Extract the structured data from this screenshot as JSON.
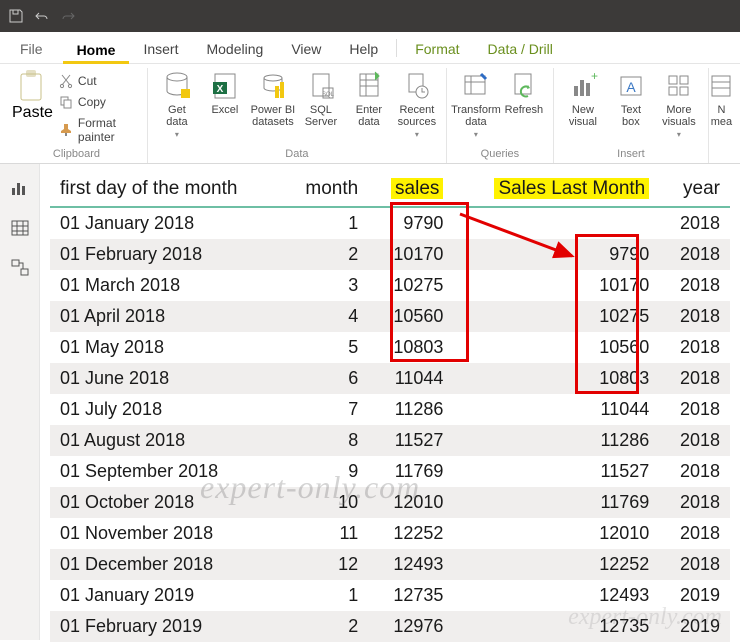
{
  "titlebar": {
    "save_icon": "save",
    "undo_icon": "undo",
    "redo_icon": "redo"
  },
  "tabs": {
    "file": "File",
    "home": "Home",
    "insert": "Insert",
    "modeling": "Modeling",
    "view": "View",
    "help": "Help",
    "format": "Format",
    "datadrill": "Data / Drill"
  },
  "ribbon": {
    "clipboard": {
      "label": "Clipboard",
      "paste": "Paste",
      "cut": "Cut",
      "copy": "Copy",
      "format_painter": "Format painter"
    },
    "data": {
      "label": "Data",
      "get_data": "Get\ndata",
      "excel": "Excel",
      "pbi_ds": "Power BI\ndatasets",
      "sql": "SQL\nServer",
      "enter": "Enter\ndata",
      "recent": "Recent\nsources"
    },
    "queries": {
      "label": "Queries",
      "transform": "Transform\ndata",
      "refresh": "Refresh"
    },
    "insert": {
      "label": "Insert",
      "new_visual": "New\nvisual",
      "textbox": "Text\nbox",
      "more": "More\nvisuals"
    },
    "calc": {
      "new_measure": "N\nmea"
    }
  },
  "table": {
    "headers": {
      "c0": "first day of the month",
      "c1": "month",
      "c2": "sales",
      "c3": "Sales Last Month",
      "c4": "year"
    },
    "rows": [
      {
        "c0": "01 January 2018",
        "c1": "1",
        "c2": "9790",
        "c3": "",
        "c4": "2018"
      },
      {
        "c0": "01 February 2018",
        "c1": "2",
        "c2": "10170",
        "c3": "9790",
        "c4": "2018"
      },
      {
        "c0": "01 March 2018",
        "c1": "3",
        "c2": "10275",
        "c3": "10170",
        "c4": "2018"
      },
      {
        "c0": "01 April 2018",
        "c1": "4",
        "c2": "10560",
        "c3": "10275",
        "c4": "2018"
      },
      {
        "c0": "01 May 2018",
        "c1": "5",
        "c2": "10803",
        "c3": "10560",
        "c4": "2018"
      },
      {
        "c0": "01 June 2018",
        "c1": "6",
        "c2": "11044",
        "c3": "10803",
        "c4": "2018"
      },
      {
        "c0": "01 July 2018",
        "c1": "7",
        "c2": "11286",
        "c3": "11044",
        "c4": "2018"
      },
      {
        "c0": "01 August 2018",
        "c1": "8",
        "c2": "11527",
        "c3": "11286",
        "c4": "2018"
      },
      {
        "c0": "01 September 2018",
        "c1": "9",
        "c2": "11769",
        "c3": "11527",
        "c4": "2018"
      },
      {
        "c0": "01 October 2018",
        "c1": "10",
        "c2": "12010",
        "c3": "11769",
        "c4": "2018"
      },
      {
        "c0": "01 November 2018",
        "c1": "11",
        "c2": "12252",
        "c3": "12010",
        "c4": "2018"
      },
      {
        "c0": "01 December 2018",
        "c1": "12",
        "c2": "12493",
        "c3": "12252",
        "c4": "2018"
      },
      {
        "c0": "01 January 2019",
        "c1": "1",
        "c2": "12735",
        "c3": "12493",
        "c4": "2019"
      },
      {
        "c0": "01 February 2019",
        "c1": "2",
        "c2": "12976",
        "c3": "12735",
        "c4": "2019"
      }
    ]
  },
  "watermark": "expert-only.com",
  "watermark2": "expert-only.com"
}
